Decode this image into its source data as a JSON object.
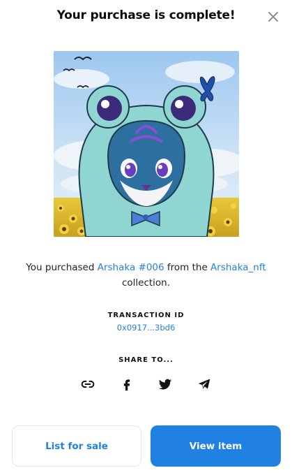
{
  "header": {
    "title": "Your purchase is complete!",
    "close_icon": "close-icon"
  },
  "nft": {
    "image_icon": "nft-artwork"
  },
  "purchase": {
    "prefix": "You purchased ",
    "item_name": "Arshaka #006",
    "middle": " from the ",
    "collection_name": "Arshaka_nft",
    "suffix": " collection."
  },
  "transaction": {
    "label": "TRANSACTION ID",
    "value": "0x0917...3bd6"
  },
  "share": {
    "label": "SHARE TO...",
    "icons": [
      "link-icon",
      "facebook-icon",
      "twitter-icon",
      "telegram-icon"
    ]
  },
  "actions": {
    "list_label": "List for sale",
    "view_label": "View item"
  },
  "colors": {
    "accent": "#2181e2",
    "text": "#111111",
    "border": "#e2e4e8"
  }
}
